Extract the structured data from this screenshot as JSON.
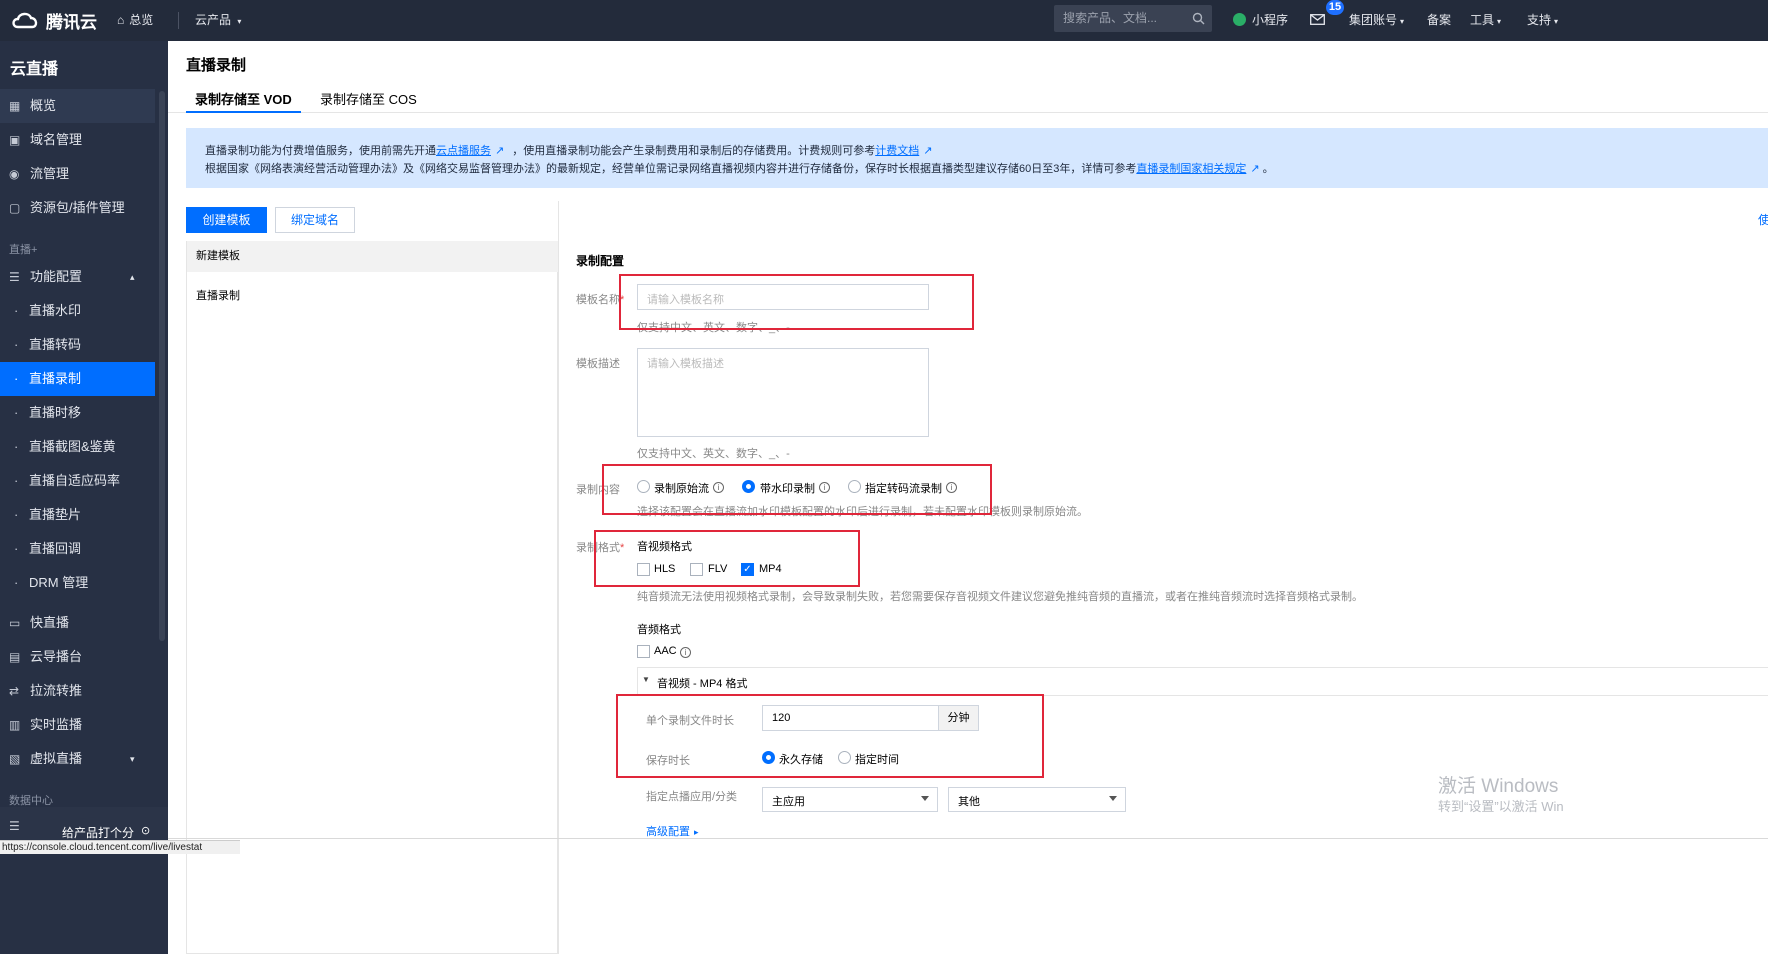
{
  "topnav": {
    "brand": "腾讯云",
    "overview": "总览",
    "products": "云产品",
    "search_placeholder": "搜索产品、文档...",
    "mini_program": "小程序",
    "mail_badge": "15",
    "account": "集团账号",
    "filing": "备案",
    "tools": "工具",
    "support": "支持"
  },
  "sidebar": {
    "title": "云直播",
    "items": [
      {
        "label": "概览",
        "icon": "grid-icon"
      },
      {
        "label": "域名管理",
        "icon": "www-icon"
      },
      {
        "label": "流管理",
        "icon": "play-circle-icon"
      },
      {
        "label": "资源包/插件管理",
        "icon": "package-icon"
      }
    ],
    "section_live": "直播+",
    "feature_config": "功能配置",
    "subitems": [
      "直播水印",
      "直播转码",
      "直播录制",
      "直播时移",
      "直播截图&鉴黄",
      "直播自适应码率",
      "直播垫片",
      "直播回调",
      "DRM 管理"
    ],
    "items2": [
      {
        "label": "快直播",
        "icon": "video-icon"
      },
      {
        "label": "云导播台",
        "icon": "monitor-icon"
      },
      {
        "label": "拉流转推",
        "icon": "relay-icon"
      },
      {
        "label": "实时监播",
        "icon": "calendar-icon"
      },
      {
        "label": "虚拟直播",
        "icon": "virtual-icon"
      }
    ],
    "section_data": "数据中心",
    "feedback": "给产品打个分"
  },
  "page": {
    "title": "直播录制",
    "tabs": [
      "录制存储至 VOD",
      "录制存储至 COS"
    ],
    "notice_line1_a": "直播录制功能为付费增值服务，使用前需先开通",
    "notice_link1": "云点播服务",
    "notice_line1_b": "，使用直播录制功能会产生录制费用和录制后的存储费用。计费规则可参考",
    "notice_link2": "计费文档",
    "notice_line2_a": "根据国家《网络表演经营活动管理办法》及《网络交易监督管理办法》的最新规定，经营单位需记录网络直播视频内容并进行存储备份，保存时长根据直播类型建议存储60日至3年，详情可参考",
    "notice_link3": "直播录制国家相关规定",
    "notice_line2_end": "。",
    "btn_create": "创建模板",
    "btn_bind": "绑定域名",
    "right_edge_text": "使",
    "left_rows": [
      "新建模板",
      "直播录制"
    ]
  },
  "form": {
    "section_title": "录制配置",
    "name_label": "模板名称",
    "name_placeholder": "请输入模板名称",
    "name_hint": "仅支持中文、英文、数字、_、-",
    "desc_label": "模板描述",
    "desc_placeholder": "请输入模板描述",
    "desc_hint": "仅支持中文、英文、数字、_、-",
    "content_label": "录制内容",
    "content_options": [
      "录制原始流",
      "带水印录制",
      "指定转码流录制"
    ],
    "content_selected": "带水印录制",
    "content_hint": "选择该配置会在直播流加水印模板配置的水印后进行录制，若未配置水印模板则录制原始流。",
    "format_label": "录制格式",
    "av_format_title": "音视频格式",
    "av_formats": [
      {
        "label": "HLS",
        "checked": false
      },
      {
        "label": "FLV",
        "checked": false
      },
      {
        "label": "MP4",
        "checked": true
      }
    ],
    "format_hint": "纯音频流无法使用视频格式录制，会导致录制失败，若您需要保存音视频文件建议您避免推纯音频的直播流，或者在推纯音频流时选择音频格式录制。",
    "audio_format_title": "音频格式",
    "audio_formats": [
      {
        "label": "AAC",
        "checked": false
      }
    ],
    "panel_title": "音视频 - MP4 格式",
    "file_duration_label": "单个录制文件时长",
    "file_duration_value": "120",
    "file_duration_unit": "分钟",
    "retention_label": "保存时长",
    "retention_options": [
      "永久存储",
      "指定时间"
    ],
    "retention_selected": "永久存储",
    "vod_app_label": "指定点播应用/分类",
    "vod_app_value": "主应用",
    "vod_class_value": "其他",
    "advanced": "高级配置"
  },
  "windows_watermark": {
    "line1": "激活 Windows",
    "line2": "转到“设置”以激活 Win"
  },
  "status_url": "https://console.cloud.tencent.com/live/livestat"
}
